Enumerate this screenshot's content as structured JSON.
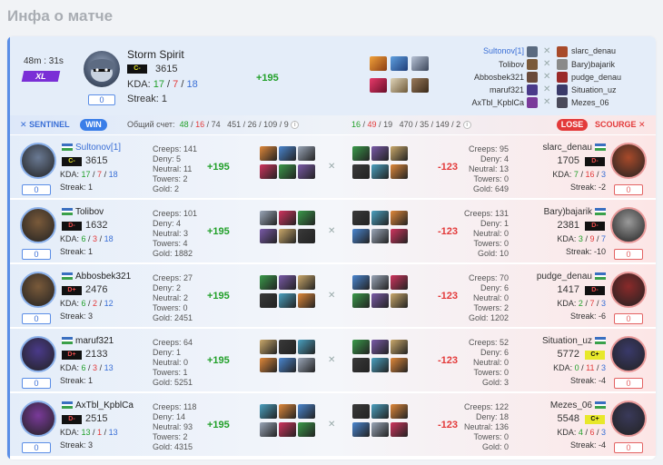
{
  "page_title": "Инфа о матче",
  "summary": {
    "duration": "48m : 31s",
    "badge": "XL",
    "hero_name": "Storm Spirit",
    "rank": "C-",
    "mmr": "3615",
    "kda_label": "KDA:",
    "kda_k": "17",
    "kda_d": "7",
    "kda_a": "18",
    "streak": "Streak: 1",
    "pill": "0",
    "delta": "+195",
    "roster_left": [
      "Sultonov[1]",
      "Tolibov",
      "Abbosbek321",
      "maruf321",
      "AxTbl_KpblCa"
    ],
    "roster_right": [
      "slarc_denau",
      "Bary)bajarik",
      "pudge_denau",
      "Situation_uz",
      "Mezes_06"
    ]
  },
  "teams": {
    "sentinel_label": "SENTINEL",
    "win_label": "WIN",
    "total_label": "Общий счет:",
    "left_k": "48",
    "left_d": "16",
    "left_a": "74",
    "left_extra": "451 / 26 / 109 / 9",
    "right_k": "16",
    "right_d": "49",
    "right_a": "19",
    "right_extra": "470 / 35 / 149 / 2",
    "lose_label": "LOSE",
    "scourge_label": "SCOURGE"
  },
  "players": [
    {
      "left": {
        "name": "Sultonov[1]",
        "rank": "C-",
        "mmr": "3615",
        "k": "17",
        "d": "7",
        "a": "18",
        "streak": "Streak: 1",
        "pill": "0",
        "creeps": "Creeps: 141",
        "deny": "Deny: 5",
        "neutral": "Neutral: 11",
        "towers": "Towers: 2",
        "gold": "Gold: 2"
      },
      "delta_left": "+195",
      "delta_right": "-123",
      "right": {
        "name": "slarc_denau",
        "mmr": "1705",
        "rank": "D-",
        "k": "7",
        "d": "16",
        "a": "3",
        "streak": "Streak: -2",
        "pill": "0",
        "creeps": "Creeps: 95",
        "deny": "Deny: 4",
        "neutral": "Neutral: 13",
        "towers": "Towers: 0",
        "gold": "Gold: 649"
      }
    },
    {
      "left": {
        "name": "Tolibov",
        "rank": "D-",
        "mmr": "1632",
        "k": "6",
        "d": "3",
        "a": "18",
        "streak": "Streak: 1",
        "pill": "0",
        "creeps": "Creeps: 101",
        "deny": "Deny: 4",
        "neutral": "Neutral: 3",
        "towers": "Towers: 4",
        "gold": "Gold: 1882"
      },
      "delta_left": "+195",
      "delta_right": "-123",
      "right": {
        "name": "Bary)bajarik",
        "mmr": "2381",
        "rank": "D-",
        "k": "3",
        "d": "9",
        "a": "7",
        "streak": "Streak: -10",
        "pill": "0",
        "creeps": "Creeps: 131",
        "deny": "Deny: 1",
        "neutral": "Neutral: 0",
        "towers": "Towers: 0",
        "gold": "Gold: 10"
      }
    },
    {
      "left": {
        "name": "Abbosbek321",
        "rank": "D+",
        "mmr": "2476",
        "k": "6",
        "d": "2",
        "a": "12",
        "streak": "Streak: 3",
        "pill": "0",
        "creeps": "Creeps: 27",
        "deny": "Deny: 2",
        "neutral": "Neutral: 2",
        "towers": "Towers: 0",
        "gold": "Gold: 2451"
      },
      "delta_left": "+195",
      "delta_right": "-123",
      "right": {
        "name": "pudge_denau",
        "mmr": "1417",
        "rank": "D-",
        "k": "2",
        "d": "7",
        "a": "3",
        "streak": "Streak: -6",
        "pill": "0",
        "creeps": "Creeps: 70",
        "deny": "Deny: 6",
        "neutral": "Neutral: 0",
        "towers": "Towers: 2",
        "gold": "Gold: 1202"
      }
    },
    {
      "left": {
        "name": "maruf321",
        "rank": "D+",
        "mmr": "2133",
        "k": "6",
        "d": "3",
        "a": "13",
        "streak": "Streak: 1",
        "pill": "0",
        "creeps": "Creeps: 64",
        "deny": "Deny: 1",
        "neutral": "Neutral: 0",
        "towers": "Towers: 1",
        "gold": "Gold: 5251"
      },
      "delta_left": "+195",
      "delta_right": "-123",
      "right": {
        "name": "Situation_uz",
        "mmr": "5772",
        "rank": "C+",
        "k": "0",
        "d": "11",
        "a": "3",
        "streak": "Streak: -4",
        "pill": "0",
        "creeps": "Creeps: 52",
        "deny": "Deny: 6",
        "neutral": "Neutral: 0",
        "towers": "Towers: 0",
        "gold": "Gold: 3"
      }
    },
    {
      "left": {
        "name": "AxTbl_KpblCa",
        "rank": "D-",
        "mmr": "2515",
        "k": "13",
        "d": "1",
        "a": "13",
        "streak": "Streak: 3",
        "pill": "0",
        "creeps": "Creeps: 118",
        "deny": "Deny: 14",
        "neutral": "Neutral: 93",
        "towers": "Towers: 2",
        "gold": "Gold: 4315"
      },
      "delta_left": "+195",
      "delta_right": "-123",
      "right": {
        "name": "Mezes_06",
        "mmr": "5548",
        "rank": "C+",
        "k": "4",
        "d": "6",
        "a": "3",
        "streak": "Streak: -4",
        "pill": "0",
        "creeps": "Creeps: 122",
        "deny": "Deny: 18",
        "neutral": "Neutral: 136",
        "towers": "Towers: 0",
        "gold": "Gold: 0"
      }
    }
  ]
}
